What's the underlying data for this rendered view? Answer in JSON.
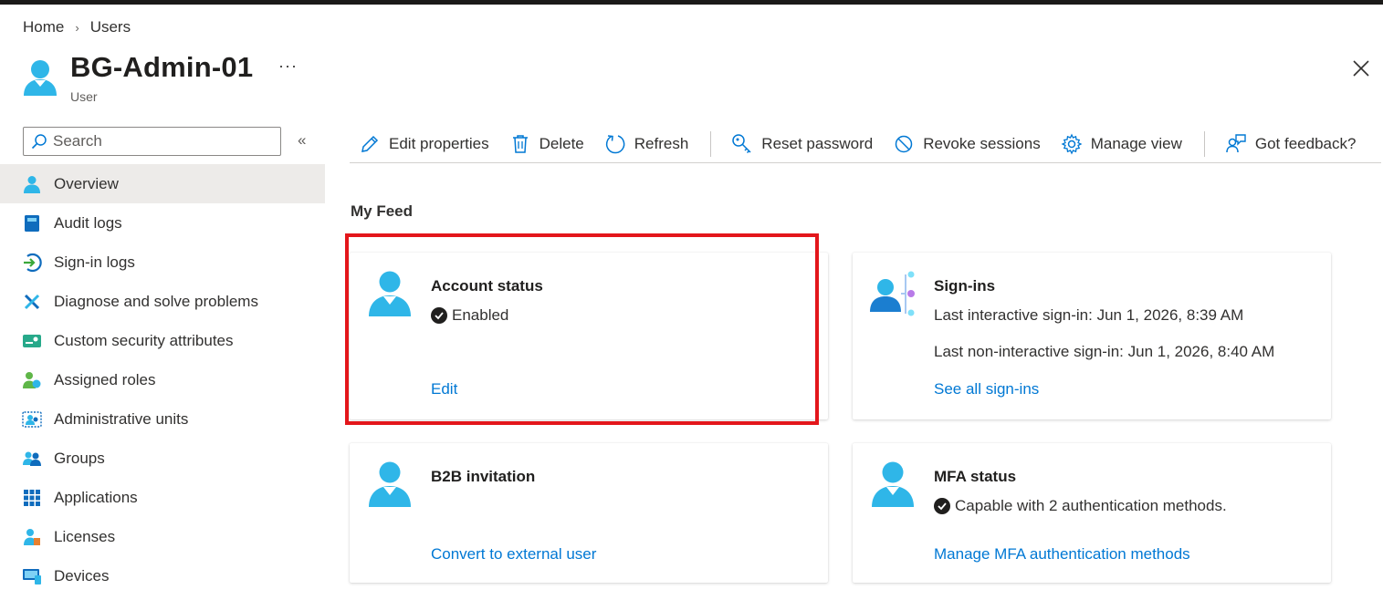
{
  "breadcrumb": {
    "home": "Home",
    "current": "Users"
  },
  "header": {
    "title": "BG-Admin-01",
    "subtitle": "User",
    "more": "···"
  },
  "sidebar": {
    "search_placeholder": "Search",
    "collapse": "«",
    "items": [
      {
        "label": "Overview",
        "icon": "user-icon",
        "active": true
      },
      {
        "label": "Audit logs",
        "icon": "audit-log-icon"
      },
      {
        "label": "Sign-in logs",
        "icon": "sign-in-icon"
      },
      {
        "label": "Diagnose and solve problems",
        "icon": "wrench-icon"
      },
      {
        "label": "Custom security attributes",
        "icon": "security-attributes-icon"
      },
      {
        "label": "Assigned roles",
        "icon": "roles-icon"
      },
      {
        "label": "Administrative units",
        "icon": "admin-units-icon"
      },
      {
        "label": "Groups",
        "icon": "groups-icon"
      },
      {
        "label": "Applications",
        "icon": "applications-icon"
      },
      {
        "label": "Licenses",
        "icon": "licenses-icon"
      },
      {
        "label": "Devices",
        "icon": "devices-icon"
      }
    ]
  },
  "toolbar": {
    "edit": "Edit properties",
    "delete": "Delete",
    "refresh": "Refresh",
    "reset_password": "Reset password",
    "revoke_sessions": "Revoke sessions",
    "manage_view": "Manage view",
    "feedback": "Got feedback?"
  },
  "feed": {
    "title": "My Feed",
    "account_status": {
      "title": "Account status",
      "status": "Enabled",
      "link": "Edit"
    },
    "sign_ins": {
      "title": "Sign-ins",
      "last_interactive": "Last interactive sign-in: Jun 1, 2026, 8:39 AM",
      "last_non_interactive": "Last non-interactive sign-in: Jun 1, 2026, 8:40 AM",
      "link": "See all sign-ins"
    },
    "b2b": {
      "title": "B2B invitation",
      "link": "Convert to external user"
    },
    "mfa": {
      "title": "MFA status",
      "status": "Capable with 2 authentication methods.",
      "link": "Manage MFA authentication methods"
    }
  },
  "colors": {
    "accent": "#0078d4",
    "highlight": "#e3161b",
    "user_icon": "#2fb6e8"
  }
}
